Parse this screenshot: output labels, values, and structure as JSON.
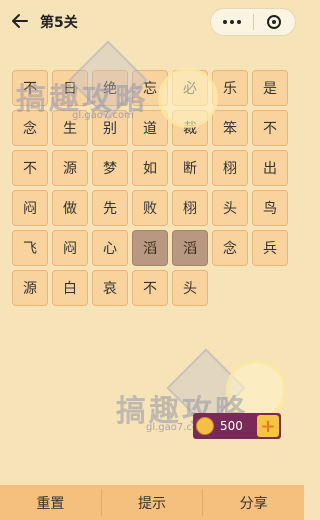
{
  "header": {
    "title": "第5关"
  },
  "grid": {
    "rows": [
      [
        "不",
        "日",
        "绝",
        "忘",
        "必",
        "乐",
        "是"
      ],
      [
        "念",
        "生",
        "别",
        "道",
        "裁",
        "笨",
        "不"
      ],
      [
        "不",
        "源",
        "梦",
        "如",
        "断",
        "栩",
        "出"
      ],
      [
        "闷",
        "做",
        "先",
        "败",
        "栩",
        "头",
        "鸟"
      ],
      [
        "飞",
        "闷",
        "心",
        "滔",
        "滔",
        "念",
        "兵"
      ],
      [
        "源",
        "白",
        "哀",
        "不",
        "头"
      ]
    ],
    "selected": [
      [
        4,
        3
      ],
      [
        4,
        4
      ]
    ]
  },
  "watermark": {
    "text": "搞趣攻略",
    "url": "gl.gao7.com"
  },
  "coins": {
    "count": "500",
    "add_symbol": "+"
  },
  "bottom": {
    "reset": "重置",
    "hint": "提示",
    "share": "分享"
  },
  "colors": {
    "background": "#f7e3b8",
    "cell": "#f9d39e",
    "cell_selected": "#b89880",
    "bottom_bar": "#f5c07d",
    "coin_box": "#7a2a58"
  }
}
